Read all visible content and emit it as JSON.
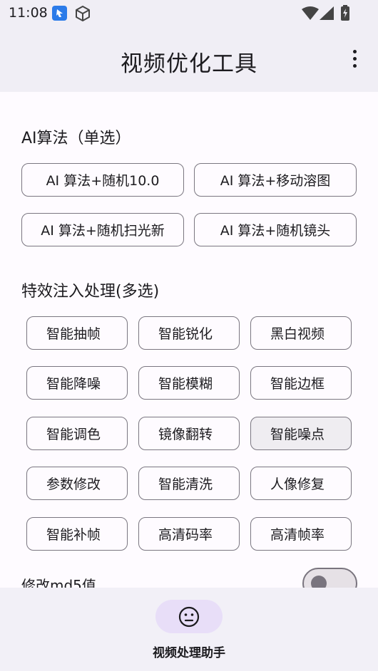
{
  "status_bar": {
    "time": "11:08"
  },
  "app_bar": {
    "title": "视频优化工具"
  },
  "algo_section": {
    "title": "AI算法（单选）",
    "options": [
      "AI 算法+随机10.0",
      "AI 算法+移动溶图",
      "AI 算法+随机扫光新",
      "AI 算法+随机镜头"
    ]
  },
  "effects_section": {
    "title": "特效注入处理(多选)",
    "options": [
      "智能抽帧",
      "智能锐化",
      "黑白视频",
      "智能降噪",
      "智能模糊",
      "智能边框",
      "智能调色",
      "镜像翻转",
      "智能噪点",
      "参数修改",
      "智能清洗",
      "人像修复",
      "智能补帧",
      "高清码率",
      "高清帧率"
    ],
    "selected": [
      "智能噪点"
    ]
  },
  "md5_toggle": {
    "label": "修改md5值",
    "enabled": false
  },
  "bottom_nav": {
    "items": [
      {
        "label": "视频处理助手",
        "icon": "neutral-face-icon",
        "active": true
      }
    ]
  },
  "colors": {
    "accent_container": "#e8def8",
    "surface": "#fefbff",
    "bar": "#f0eef5",
    "outline": "#79747e"
  }
}
